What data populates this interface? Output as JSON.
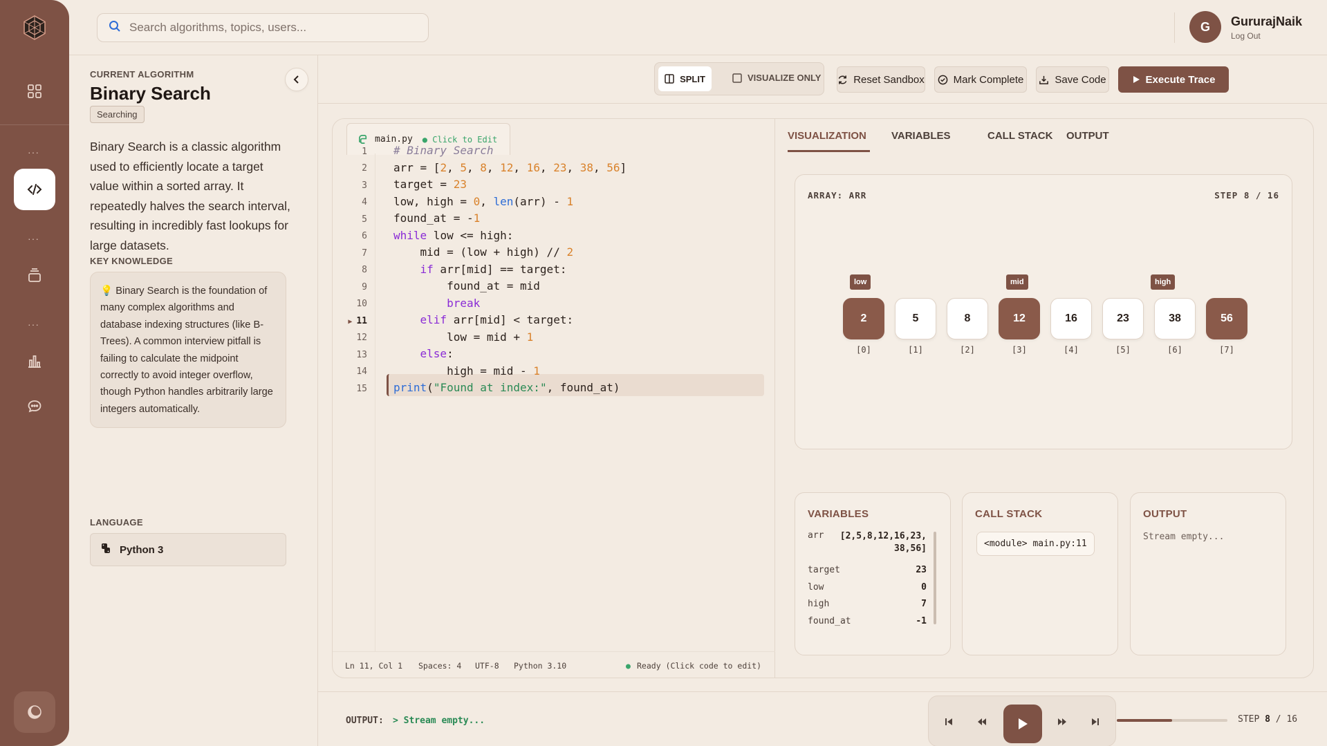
{
  "search": {
    "placeholder": "Search algorithms, topics, users..."
  },
  "user": {
    "initial": "G",
    "name": "GururajNaik",
    "logout": "Log Out"
  },
  "rail": {
    "dots": "···"
  },
  "info": {
    "current_label": "CURRENT ALGORITHM",
    "title": "Binary Search",
    "tag": "Searching",
    "description": "Binary Search is a classic algorithm used to efficiently locate a target value within a sorted array. It repeatedly halves the search interval, resulting in incredibly fast lookups for large datasets.",
    "knowledge_label": "KEY KNOWLEDGE",
    "knowledge": "Binary Search is the foundation of many complex algorithms and database indexing structures (like B-Trees). A common interview pitfall is failing to calculate the midpoint correctly to avoid integer overflow, though Python handles arbitrarily large integers automatically.",
    "language_label": "LANGUAGE",
    "language": "Python 3"
  },
  "toolbar": {
    "split": "SPLIT",
    "visualize_only": "VISUALIZE ONLY",
    "reset": "Reset Sandbox",
    "mark_complete": "Mark Complete",
    "save": "Save Code",
    "execute": "Execute Trace"
  },
  "editor": {
    "filename": "main.py",
    "edit_hint": "● Click to Edit",
    "current_line": "11",
    "status": {
      "position": "Ln 11, Col 1",
      "spaces": "Spaces: 4",
      "encoding": "UTF-8",
      "lang": "Python 3.10",
      "ready": "Ready (Click code to edit)"
    }
  },
  "viz_tabs": [
    "VISUALIZATION",
    "VARIABLES",
    "CALL STACK",
    "OUTPUT"
  ],
  "array": {
    "label": "ARRAY: ARR",
    "step": "STEP 8 / 16",
    "values": [
      "2",
      "5",
      "8",
      "12",
      "16",
      "23",
      "38",
      "56"
    ],
    "indices": [
      "[0]",
      "[1]",
      "[2]",
      "[3]",
      "[4]",
      "[5]",
      "[6]",
      "[7]"
    ],
    "pointers": {
      "low": "low",
      "mid": "mid",
      "high": "high"
    }
  },
  "variables": {
    "title": "VARIABLES",
    "arr_key": "arr",
    "arr_val_1": "[2,5,8,12,16,23,",
    "arr_val_2": "38,56]",
    "target_key": "target",
    "target_val": "23",
    "low_key": "low",
    "low_val": "0",
    "high_key": "high",
    "high_val": "7",
    "found_key": "found_at",
    "found_val": "-1"
  },
  "callstack": {
    "title": "CALL STACK",
    "frame": "<module> main.py:11"
  },
  "output": {
    "title": "OUTPUT",
    "text": "Stream empty..."
  },
  "bottom": {
    "output_label": "OUTPUT:",
    "output_value": "> Stream empty...",
    "step_prefix": "STEP",
    "step_current": "8",
    "step_total": "/ 16",
    "progress": 0.5
  },
  "colors": {
    "accent": "#7e5245",
    "background": "#f3ebe2"
  }
}
